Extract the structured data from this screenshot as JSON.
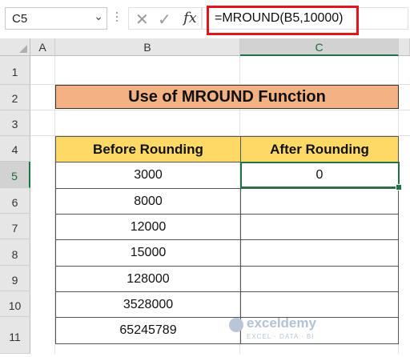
{
  "namebox": {
    "value": "C5"
  },
  "formula_bar": {
    "fx": "fx",
    "formula": "=MROUND(B5,10000)"
  },
  "columns": [
    "A",
    "B",
    "C"
  ],
  "rows": [
    "1",
    "2",
    "3",
    "4",
    "5",
    "6",
    "7",
    "8",
    "9",
    "10",
    "11"
  ],
  "title": "Use of MROUND Function",
  "table": {
    "headers": [
      "Before Rounding",
      "After Rounding"
    ],
    "rows": [
      {
        "before": "3000",
        "after": "0"
      },
      {
        "before": "8000",
        "after": ""
      },
      {
        "before": "12000",
        "after": ""
      },
      {
        "before": "15000",
        "after": ""
      },
      {
        "before": "128000",
        "after": ""
      },
      {
        "before": "3528000",
        "after": ""
      },
      {
        "before": "65245789",
        "after": ""
      }
    ]
  },
  "watermark": {
    "name": "exceldemy",
    "tagline": "EXCEL · DATA · BI"
  },
  "colors": {
    "title_fill": "#f4b183",
    "header_fill": "#ffd966",
    "selection": "#217346",
    "highlight": "#e3151c"
  }
}
